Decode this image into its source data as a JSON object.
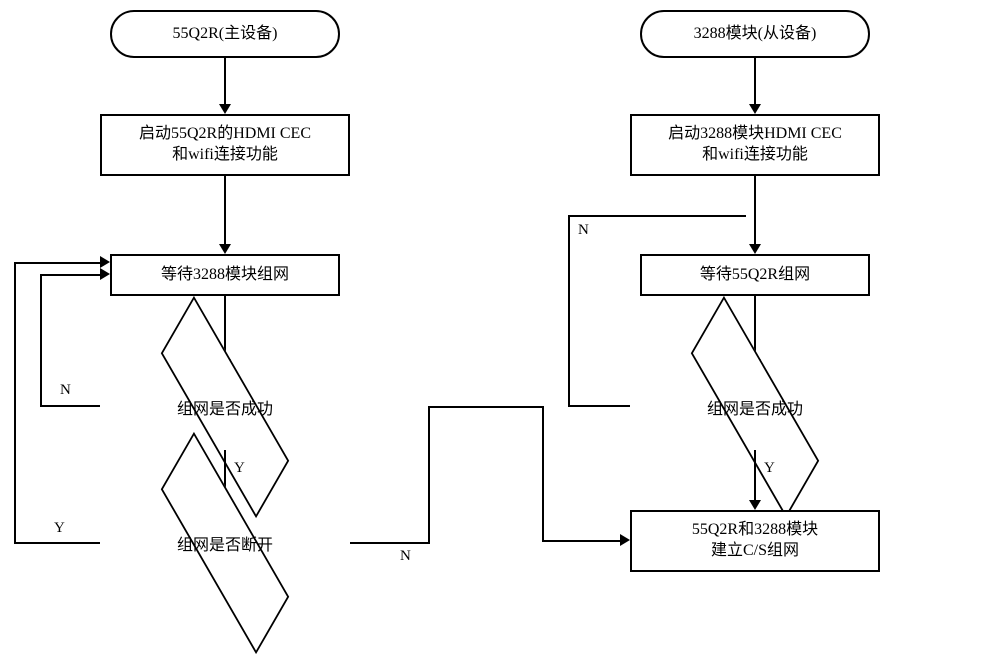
{
  "chart_data": {
    "type": "flowchart",
    "left_flow": {
      "terminal": "55Q2R(主设备)",
      "process1": "启动55Q2R的HDMI CEC\n和wifi连接功能",
      "process2": "等待3288模块组网",
      "decision1": "组网是否成功",
      "decision2": "组网是否断开"
    },
    "right_flow": {
      "terminal": "3288模块(从设备)",
      "process1": "启动3288模块HDMI CEC\n和wifi连接功能",
      "process2": "等待55Q2R组网",
      "decision1": "组网是否成功",
      "process3": "55Q2R和3288模块\n建立C/S组网"
    },
    "labels": {
      "yes": "Y",
      "no": "N"
    }
  }
}
